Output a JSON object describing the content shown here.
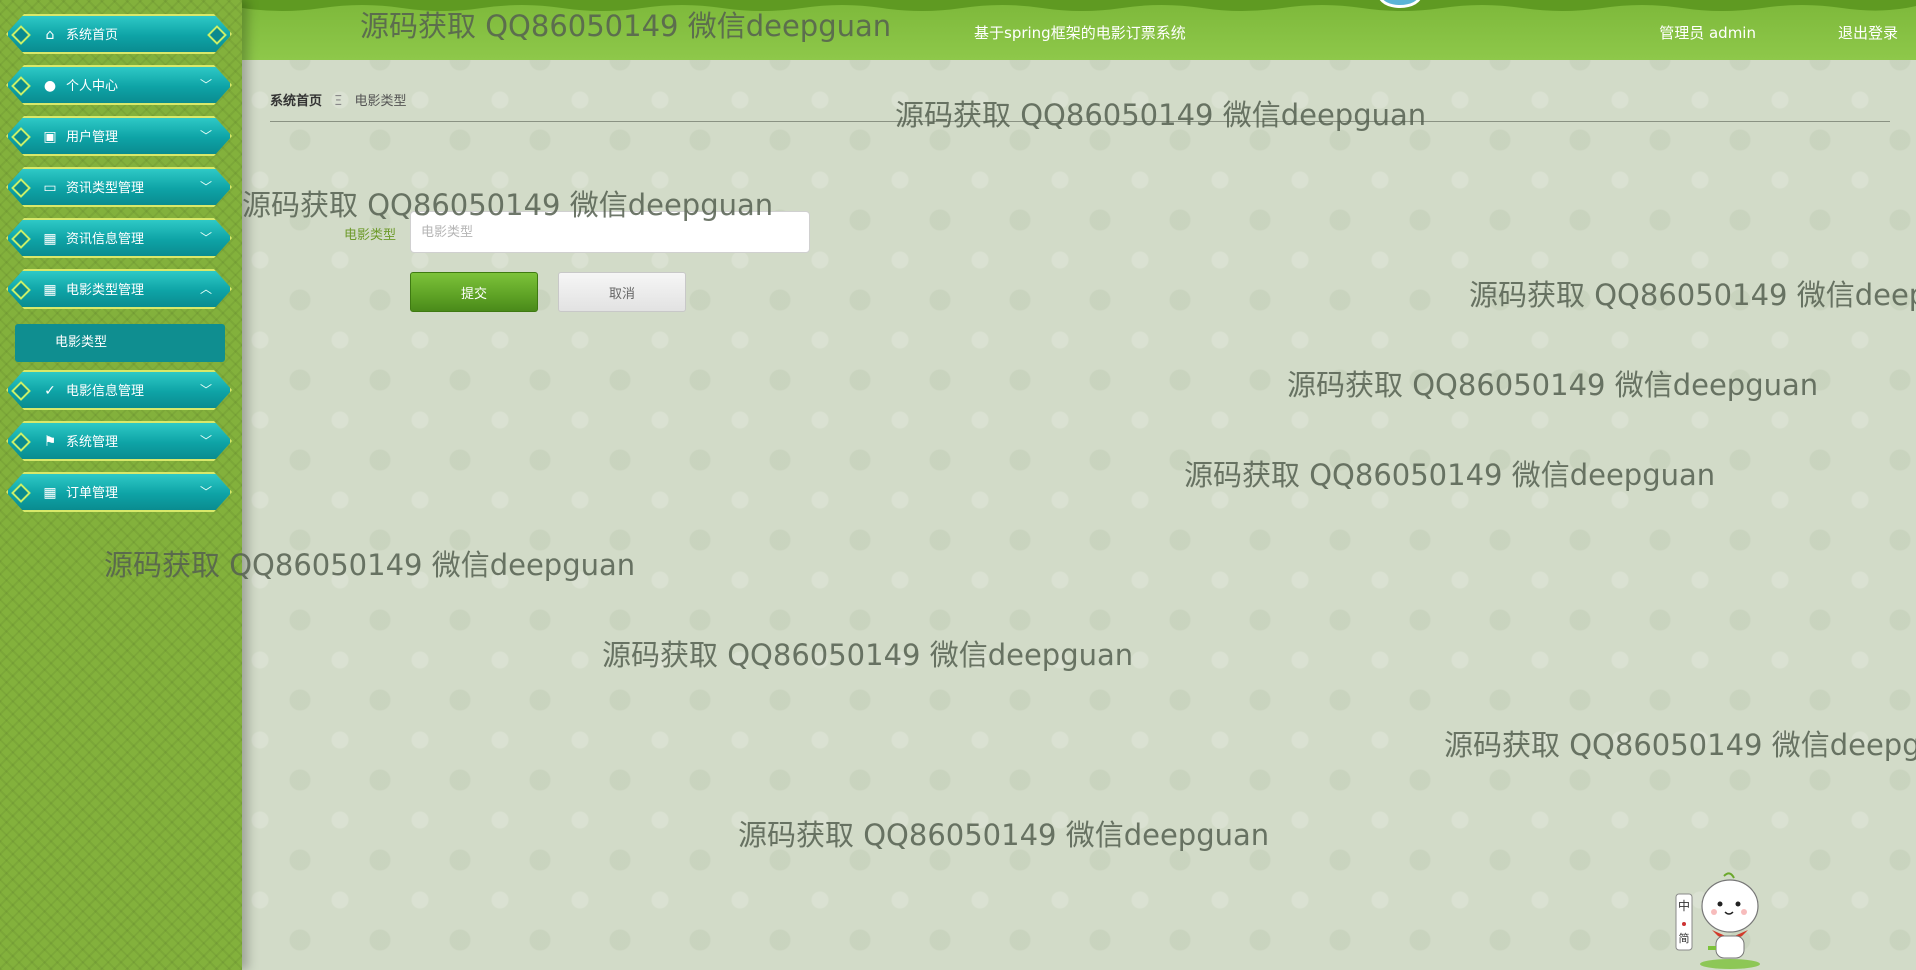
{
  "app_title": "基于spring框架的电影订票系统",
  "header": {
    "user_label": "管理员 admin",
    "logout_label": "退出登录"
  },
  "sidebar": {
    "items": [
      {
        "label": "系统首页",
        "icon": "home-icon"
      },
      {
        "label": "个人中心",
        "icon": "user-icon"
      },
      {
        "label": "用户管理",
        "icon": "briefcase-icon"
      },
      {
        "label": "资讯类型管理",
        "icon": "monitor-icon"
      },
      {
        "label": "资讯信息管理",
        "icon": "grid-icon"
      },
      {
        "label": "电影类型管理",
        "icon": "grid-icon"
      },
      {
        "label": "电影信息管理",
        "icon": "clipboard-icon"
      },
      {
        "label": "系统管理",
        "icon": "flag-icon"
      },
      {
        "label": "订单管理",
        "icon": "grid-icon"
      }
    ],
    "submenu": {
      "label": "电影类型"
    }
  },
  "breadcrumb": {
    "home": "系统首页",
    "separator": "Ξ",
    "current": "电影类型"
  },
  "form": {
    "label": "电影类型",
    "placeholder": "电影类型",
    "submit_label": "提交",
    "cancel_label": "取消"
  },
  "watermark_text": "源码获取 QQ86050149 微信deepguan",
  "mascot_text": "中 简",
  "colors": {
    "header_green": "#8ec84a",
    "sidebar_green": "#83b13c",
    "menu_teal": "#0ea3a6",
    "submit_green": "#5ea225"
  }
}
